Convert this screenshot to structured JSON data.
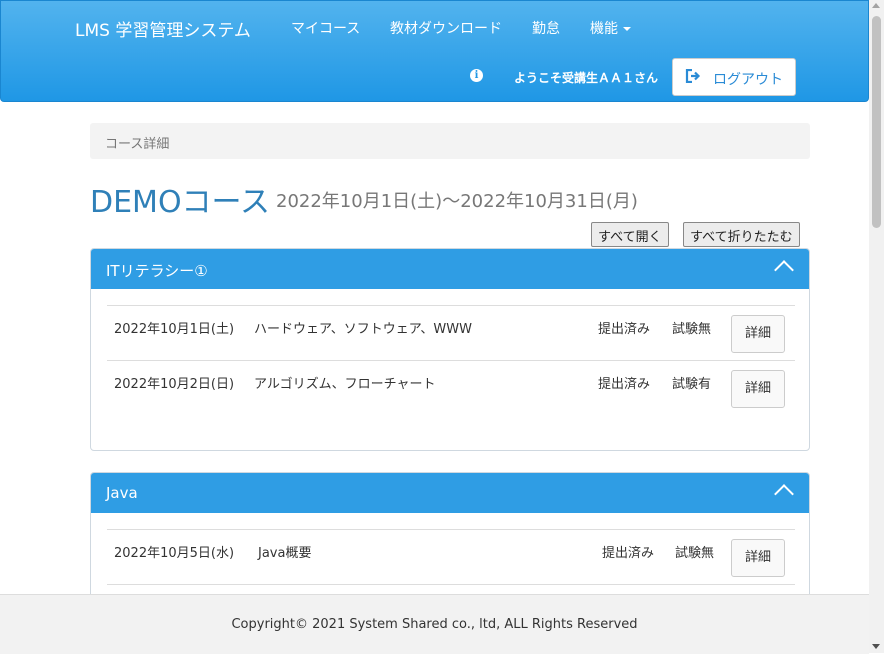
{
  "navbar": {
    "brand": "LMS 学習管理システム",
    "links": [
      "マイコース",
      "教材ダウンロード",
      "勤怠"
    ],
    "function_menu": "機能",
    "welcome": "ようこそ受講生ＡＡ１さん",
    "logout": "ログアウト",
    "info_icon": "i"
  },
  "breadcrumb": "コース詳細",
  "course": {
    "title": "DEMOコース",
    "period": "2022年10月1日(土)～2022年10月31日(月)"
  },
  "buttons": {
    "expand_all": "すべて開く",
    "collapse_all": "すべて折りたたむ"
  },
  "sections": [
    {
      "title": "ITリテラシー①",
      "rows": [
        {
          "date": "2022年10月1日(土)",
          "topic": "ハードウェア、ソフトウェア、WWW",
          "status": "提出済み",
          "exam": "試験無",
          "detail": "詳細"
        },
        {
          "date": "2022年10月2日(日)",
          "topic": "アルゴリズム、フローチャート",
          "status": "提出済み",
          "exam": "試験有",
          "detail": "詳細"
        }
      ]
    },
    {
      "title": "Java",
      "rows": [
        {
          "date": "2022年10月5日(水)",
          "topic": "Java概要",
          "status": "提出済み",
          "exam": "試験無",
          "detail": "詳細"
        }
      ]
    }
  ],
  "footer": "Copyright© 2021 System Shared co., ltd, ALL Rights Reserved",
  "colors": {
    "nav": "#1f97e5",
    "panel_header": "#2f9de4",
    "title": "#2f80b8"
  }
}
